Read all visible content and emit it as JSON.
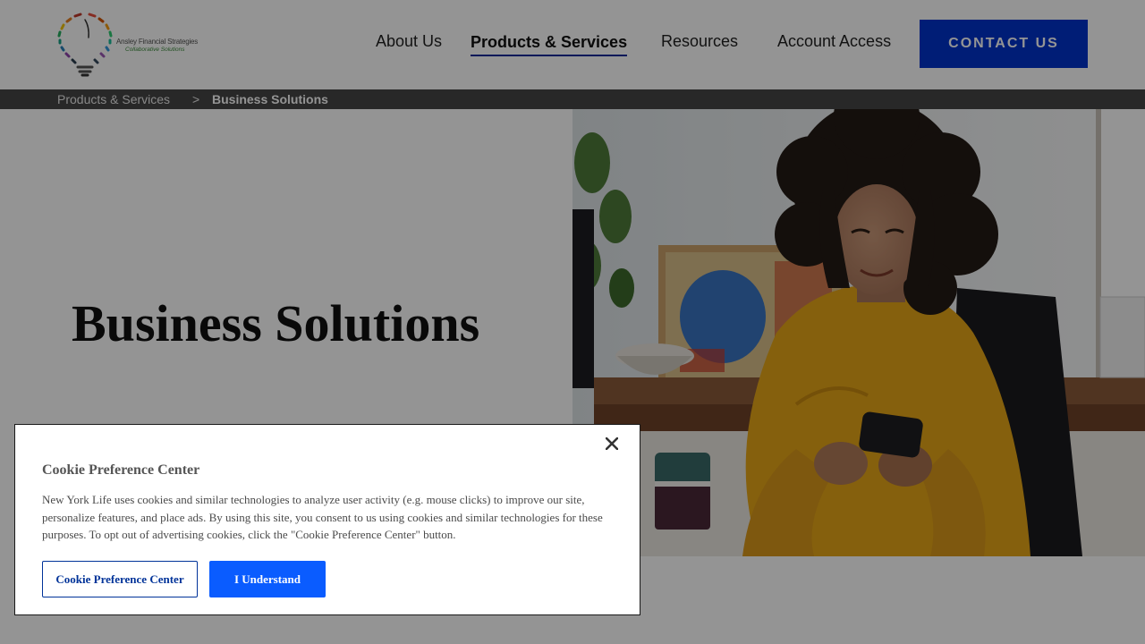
{
  "header": {
    "logo": {
      "name": "Ansley Financial Strategies",
      "tagline": "Collaborative Solutions"
    },
    "nav": [
      {
        "label": "About Us"
      },
      {
        "label": "Products & Services",
        "active": true
      },
      {
        "label": "Resources"
      },
      {
        "label": "Account Access"
      }
    ],
    "cta_label": "CONTACT US"
  },
  "breadcrumb": {
    "items": [
      "Products & Services",
      "Business Solutions"
    ],
    "separator": ">"
  },
  "hero": {
    "title": "Business Solutions",
    "image": "woman-in-yellow-sweater-holding-phone"
  },
  "cookie_dialog": {
    "title": "Cookie Preference Center",
    "body": "New York Life uses cookies and similar technologies to analyze user activity (e.g. mouse clicks) to improve our site, personalize features, and place ads. By using this site, you consent to us using cookies and similar technologies for these purposes. To opt out of advertising cookies, click the \"Cookie Preference Center\" button.",
    "pref_button": "Cookie Preference Center",
    "accept_button": "I Understand",
    "close_icon": "close-icon"
  },
  "colors": {
    "brand_blue": "#0033cc",
    "accept_blue": "#0a5cff",
    "breadcrumb_bar": "#454545",
    "sweater_yellow": "#e8a820"
  }
}
